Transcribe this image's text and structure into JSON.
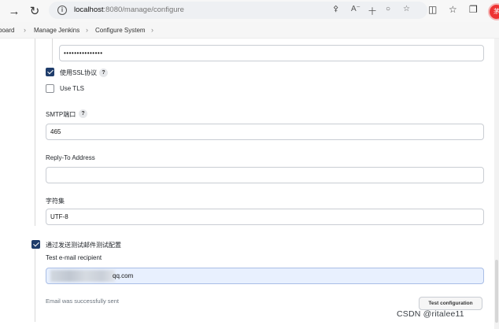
{
  "browser": {
    "url_host": "localhost",
    "url_path": ":8080/manage/configure",
    "icons": [
      "forward-icon",
      "refresh-icon",
      "info-icon",
      "key-icon",
      "read-aloud-icon",
      "translate-icon",
      "favorite-icon",
      "split-screen-icon",
      "favorites-icon",
      "collections-icon",
      "profile-icon"
    ],
    "profile_badge": "茅"
  },
  "breadcrumb": {
    "items": [
      "board",
      "Manage Jenkins",
      "Configure System"
    ]
  },
  "form": {
    "password_value": "•••••••••••••••",
    "use_ssl_label": "使用SSL协议",
    "use_ssl_checked": true,
    "use_tls_label": "Use TLS",
    "use_tls_checked": false,
    "help_glyph": "?",
    "smtp_port_label": "SMTP端口",
    "smtp_port_value": "465",
    "reply_to_label": "Reply-To Address",
    "reply_to_value": "",
    "charset_label": "字符集",
    "charset_value": "UTF-8",
    "test_mail_checkbox_label": "通过发送测试邮件测试配置",
    "test_mail_checked": true,
    "test_recipient_label": "Test e-mail recipient",
    "test_recipient_visible_value": "qq.com",
    "status_message": "Email was successfully sent",
    "test_button_label": "Test configuration"
  },
  "watermark": "CSDN @ritalee11",
  "colors": {
    "checkbox_checked": "#1f3d6b",
    "recipient_field_bg": "#e8f0fe",
    "recipient_field_border": "#a9bee6"
  }
}
